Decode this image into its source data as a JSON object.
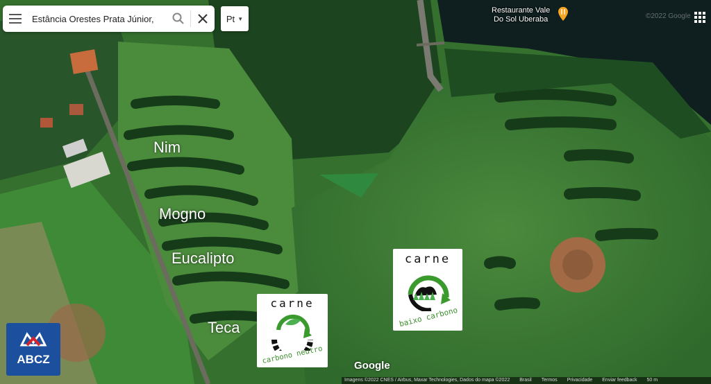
{
  "search": {
    "value": "Estância Orestes Prata Júnior,",
    "menu_icon": "hamburger-icon",
    "search_icon": "magnifier-icon",
    "close_icon": "close-icon"
  },
  "language": {
    "selected": "Pt"
  },
  "poi": {
    "name_line1": "Restaurante Vale",
    "name_line2": "Do Sol Uberaba",
    "icon": "fork-knife-pin-icon",
    "color": "#f5a623"
  },
  "copyright_top": "©2022 Google",
  "labels": {
    "nim": "Nim",
    "mogno": "Mogno",
    "eucalipto": "Eucalipto",
    "teca": "Teca"
  },
  "badges": {
    "neutro": {
      "title": "carne",
      "subtitle": "carbono neutro"
    },
    "baixo": {
      "title": "carne",
      "subtitle": "baixo carbono"
    }
  },
  "logo": {
    "text": "ABCZ",
    "color": "#1c4f9e"
  },
  "google_wordmark": "Google",
  "footer": {
    "imagery": "Imagens ©2022 CNES / Airbus, Maxar Technologies, Dados do mapa ©2022",
    "country": "Brasil",
    "terms": "Termos",
    "privacy": "Privacidade",
    "feedback": "Enviar feedback",
    "scale": "50 m"
  }
}
